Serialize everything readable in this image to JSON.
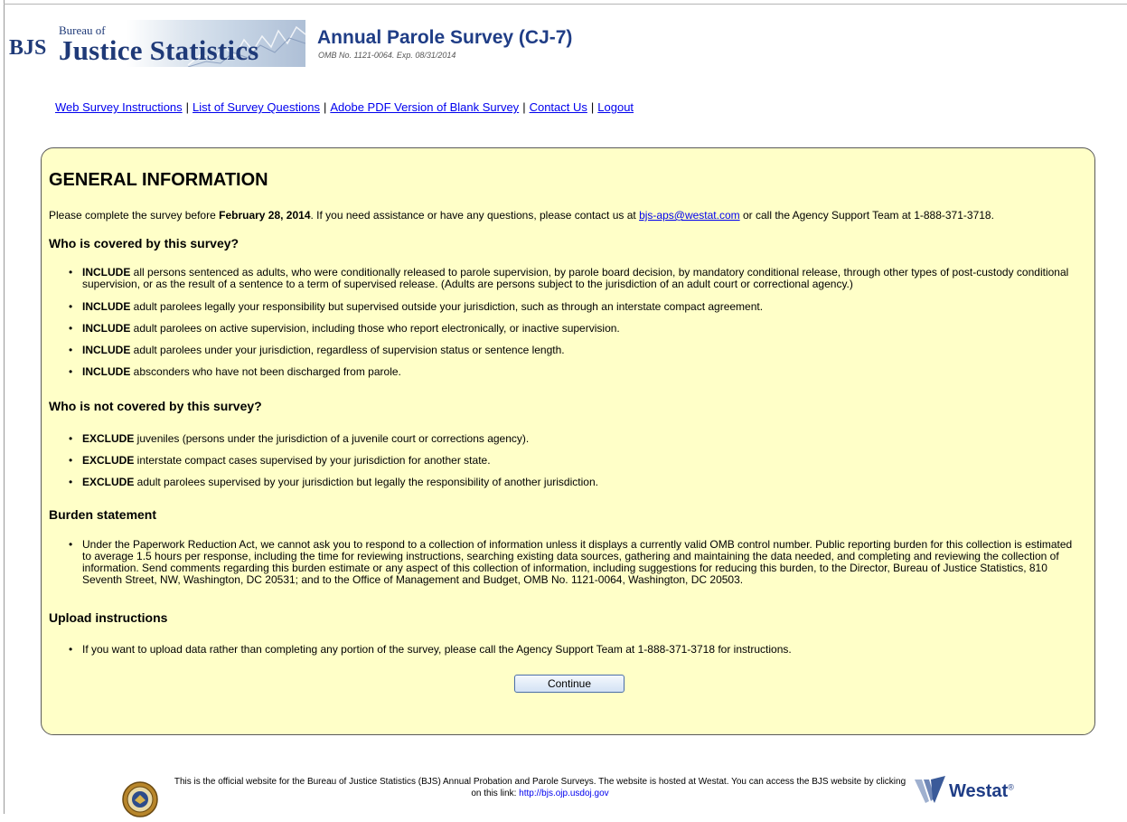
{
  "header": {
    "logo_bjs": "BJS",
    "logo_bureau": "Bureau of",
    "logo_justice": "Justice Statistics",
    "survey_title": "Annual Parole Survey (CJ-7)",
    "omb_line": "OMB No. 1121-0064. Exp. 08/31/2014"
  },
  "nav": {
    "links": [
      "Web Survey Instructions",
      "List of Survey Questions",
      "Adobe PDF Version of Blank Survey",
      "Contact Us",
      "Logout"
    ],
    "separator": "|"
  },
  "panel": {
    "title": "GENERAL INFORMATION",
    "intro_pre": "Please complete the survey before ",
    "intro_date": "February 28, 2014",
    "intro_mid": ". If you need assistance or have any questions, please contact us at ",
    "intro_email": "bjs-aps@westat.com",
    "intro_post": " or call the Agency Support Team at 1-888-371-3718.",
    "sections": [
      {
        "heading": "Who is covered by this survey?",
        "items": [
          {
            "keyword": "INCLUDE",
            "text": " all persons sentenced as adults, who were conditionally released to parole supervision, by parole board decision, by mandatory conditional release, through other types of post-custody conditional supervision, or as the result of a sentence to a term of supervised release. (Adults are persons subject to the jurisdiction of an adult court or correctional agency.)"
          },
          {
            "keyword": "INCLUDE",
            "text": " adult parolees legally your responsibility but supervised outside your jurisdiction, such as through an interstate compact agreement."
          },
          {
            "keyword": "INCLUDE",
            "text": " adult parolees on active supervision, including those who report electronically, or inactive supervision."
          },
          {
            "keyword": "INCLUDE",
            "text": " adult parolees under your jurisdiction, regardless of supervision status or sentence length."
          },
          {
            "keyword": "INCLUDE",
            "text": " absconders who have not been discharged from parole."
          }
        ]
      },
      {
        "heading": "Who is not covered by this survey?",
        "items": [
          {
            "keyword": "EXCLUDE",
            "text": " juveniles (persons under the jurisdiction of a juvenile court or corrections agency)."
          },
          {
            "keyword": "EXCLUDE",
            "text": " interstate compact cases supervised by your jurisdiction for another state."
          },
          {
            "keyword": "EXCLUDE",
            "text": " adult parolees supervised by your jurisdiction but legally the responsibility of another jurisdiction."
          }
        ]
      },
      {
        "heading": "Burden statement",
        "items": [
          {
            "keyword": "",
            "text": "Under the Paperwork Reduction Act, we cannot ask you to respond to a collection of information unless it displays a currently valid OMB control number. Public reporting burden for this collection is estimated to average 1.5 hours per response, including the time for reviewing instructions, searching existing data sources, gathering and maintaining the data needed, and completing and reviewing the collection of information. Send comments regarding this burden estimate or any aspect of this collection of information, including suggestions for reducing this burden, to the Director, Bureau of Justice Statistics, 810 Seventh Street, NW, Washington, DC 20531; and to the Office of Management and Budget, OMB No. 1121-0064, Washington, DC 20503."
          }
        ]
      },
      {
        "heading": "Upload instructions",
        "items": [
          {
            "keyword": "",
            "text": "If you want to upload data rather than completing any portion of the survey, please call the Agency Support Team at 1-888-371-3718 for instructions."
          }
        ]
      }
    ],
    "continue_label": "Continue"
  },
  "footer": {
    "text": "This is the official website for the Bureau of Justice Statistics (BJS) Annual Probation and Parole Surveys. The website is hosted at Westat. You can access the BJS website by clicking on this link: ",
    "link": "http://bjs.ojp.usdoj.gov",
    "westat": "Westat",
    "westat_mark": "®"
  },
  "colors": {
    "panel_bg": "#ffffc8",
    "title_blue": "#1f3d86",
    "link_blue": "#0000ee"
  }
}
